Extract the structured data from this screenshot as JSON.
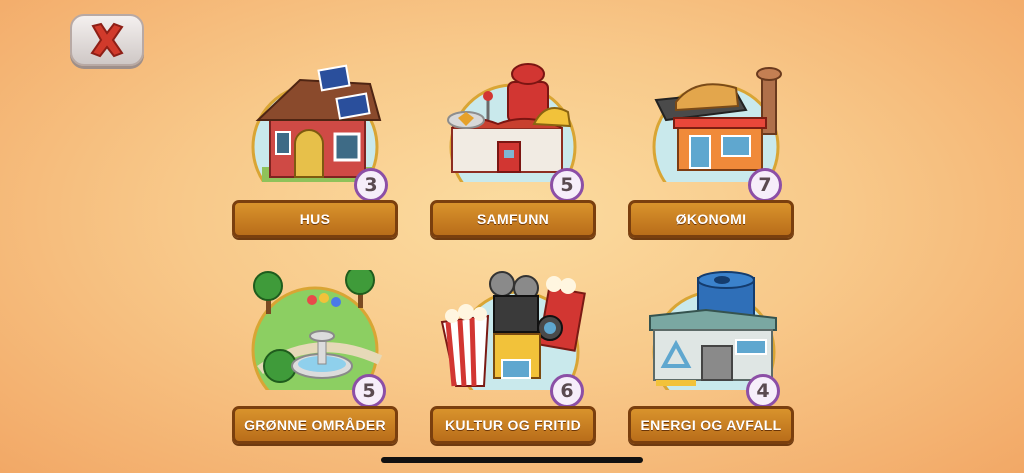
{
  "close_button": {
    "icon": "close-x-icon",
    "color": "#d13a2b"
  },
  "categories": [
    {
      "label": "HUS",
      "count": "3",
      "icon": "house-icon"
    },
    {
      "label": "SAMFUNN",
      "count": "5",
      "icon": "fire-station-icon"
    },
    {
      "label": "ØKONOMI",
      "count": "7",
      "icon": "bakery-shop-icon"
    },
    {
      "label": "GRØNNE OMRÅDER",
      "count": "5",
      "icon": "park-fountain-icon"
    },
    {
      "label": "KULTUR OG FRITID",
      "count": "6",
      "icon": "cinema-popcorn-icon"
    },
    {
      "label": "ENERGI OG AVFALL",
      "count": "4",
      "icon": "recycling-station-icon"
    }
  ]
}
